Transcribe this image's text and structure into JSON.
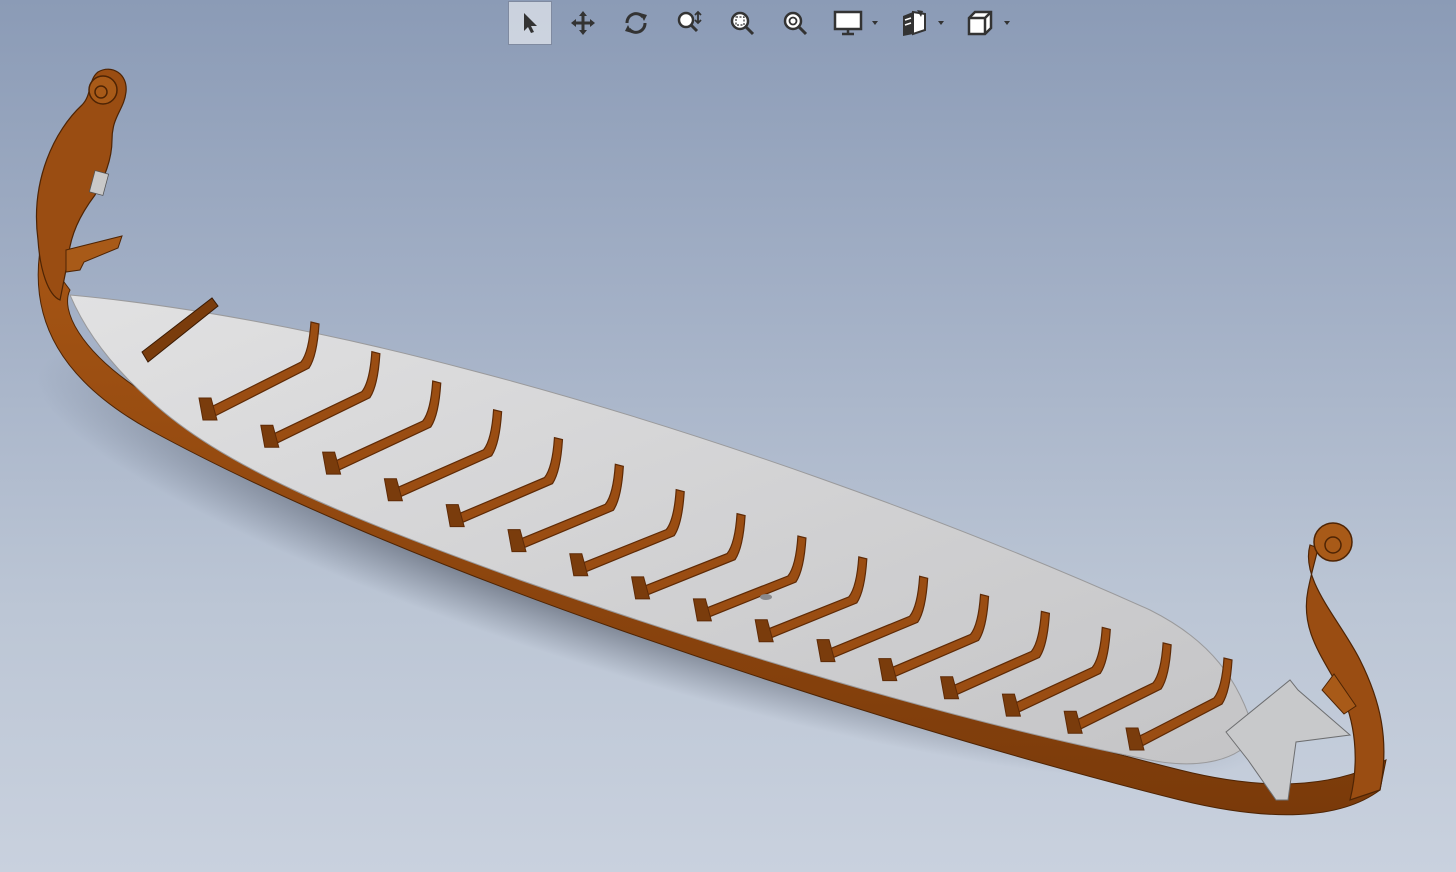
{
  "app": {
    "name": "3D CAD viewport"
  },
  "toolbar": {
    "items": [
      {
        "id": "select",
        "icon": "arrow-pointer-icon",
        "active": true
      },
      {
        "id": "pan",
        "icon": "move-arrows-icon"
      },
      {
        "id": "rotate",
        "icon": "rotate-icon"
      },
      {
        "id": "zoom-dynamic",
        "icon": "zoom-in-out-icon"
      },
      {
        "id": "zoom-area",
        "icon": "zoom-area-icon"
      },
      {
        "id": "zoom-fit",
        "icon": "zoom-fit-icon"
      },
      {
        "id": "display-style",
        "icon": "monitor-icon",
        "dropdown": true
      },
      {
        "id": "view-orientation",
        "icon": "view-cube-icon",
        "dropdown": true
      },
      {
        "id": "standard-views",
        "icon": "box-outline-icon",
        "dropdown": true
      }
    ]
  },
  "scene": {
    "model": "viking-longship",
    "rib_count": 16,
    "colors": {
      "background_top": "#8b9bb6",
      "background_bottom": "#c9d1de",
      "wood": "#9a4d12",
      "wood_dark": "#5e2a06",
      "deck": "#cfcfd0",
      "shadow": "#2a3140"
    }
  }
}
